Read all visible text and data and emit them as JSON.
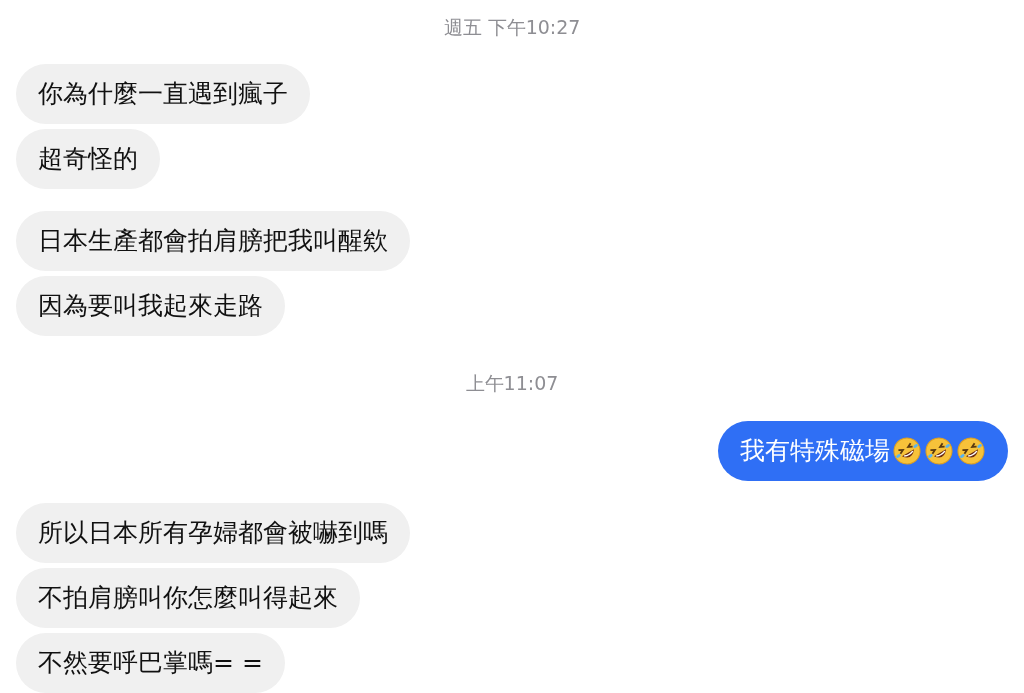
{
  "items": [
    {
      "kind": "timestamp",
      "text": "週五 下午10:27"
    },
    {
      "kind": "group",
      "sent": false,
      "messages": [
        {
          "text": "你為什麼一直遇到瘋子"
        },
        {
          "text": "超奇怪的"
        }
      ]
    },
    {
      "kind": "group",
      "sent": false,
      "messages": [
        {
          "text": "日本生產都會拍肩膀把我叫醒欸"
        },
        {
          "text": "因為要叫我起來走路"
        }
      ]
    },
    {
      "kind": "timestamp",
      "text": "上午11:07"
    },
    {
      "kind": "group",
      "sent": true,
      "messages": [
        {
          "text": "我有特殊磁場",
          "emoji": [
            {
              "kind": "rolling-laughing"
            },
            {
              "kind": "rolling-laughing"
            },
            {
              "kind": "rolling-laughing"
            }
          ]
        }
      ]
    },
    {
      "kind": "group",
      "sent": false,
      "messages": [
        {
          "text": "所以日本所有孕婦都會被嚇到嗎"
        },
        {
          "text": "不拍肩膀叫你怎麼叫得起來"
        },
        {
          "text": "不然要呼巴掌嗎= ="
        }
      ]
    }
  ]
}
